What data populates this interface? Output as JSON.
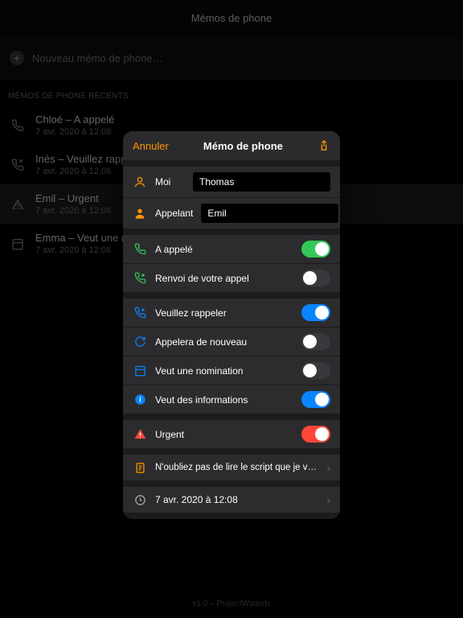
{
  "header": {
    "title": "Mémos de phone"
  },
  "new_memo": {
    "label": "Nouveau mémo de phone…"
  },
  "section": {
    "label": "MÉMOS DE PHONE RÉCENTS"
  },
  "list": [
    {
      "title": "Chloé – A appelé",
      "sub": "7 avr. 2020 à 12:08"
    },
    {
      "title": "Inès – Veuillez rappeler",
      "sub": "7 avr. 2020 à 12:08"
    },
    {
      "title": "Emil – Urgent",
      "sub": "7 avr. 2020 à 12:08"
    },
    {
      "title": "Emma – Veut une nomination",
      "sub": "7 avr. 2020 à 12:08"
    }
  ],
  "modal": {
    "cancel": "Annuler",
    "title": "Mémo de phone",
    "me_label": "Moi",
    "me_value": "Thomas",
    "caller_label": "Appelant",
    "caller_value": "Emil",
    "rows": {
      "called": "A appelé",
      "returned": "Renvoi de votre appel",
      "callback": "Veuillez rappeler",
      "willcall": "Appelera de nouveau",
      "appointment": "Veut une nomination",
      "info": "Veut des informations",
      "urgent": "Urgent"
    },
    "note": "N'oubliez pas de lire le script que je vous ai envoyé.",
    "date": "7 avr. 2020 à 12:08"
  },
  "footer": "v1.0 – ProjectWizards"
}
